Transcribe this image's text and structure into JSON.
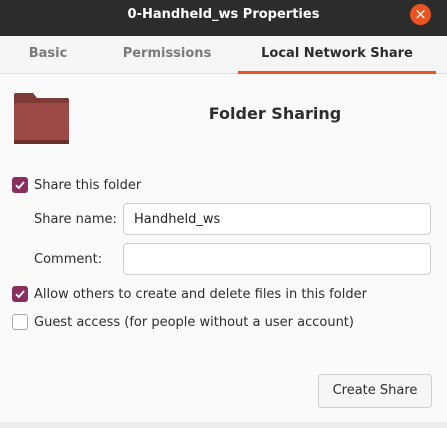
{
  "window": {
    "title": "0-Handheld_ws Properties",
    "close_glyph": "×",
    "accent_color": "#e95420",
    "check_color": "#8a2e5e"
  },
  "tabs": [
    {
      "label": "Basic",
      "selected": false
    },
    {
      "label": "Permissions",
      "selected": false
    },
    {
      "label": "Local Network Share",
      "selected": true
    }
  ],
  "header": {
    "icon": "folder-icon",
    "title": "Folder Sharing"
  },
  "share": {
    "label": "Share this folder",
    "checked": true,
    "name_label": "Share name:",
    "name_value": "Handheld_ws",
    "comment_label": "Comment:",
    "comment_value": ""
  },
  "options": {
    "allow_label": "Allow others to create and delete files in this folder",
    "allow_checked": true,
    "guest_label": "Guest access (for people without a user account)",
    "guest_checked": false
  },
  "actions": {
    "create_label": "Create Share"
  }
}
